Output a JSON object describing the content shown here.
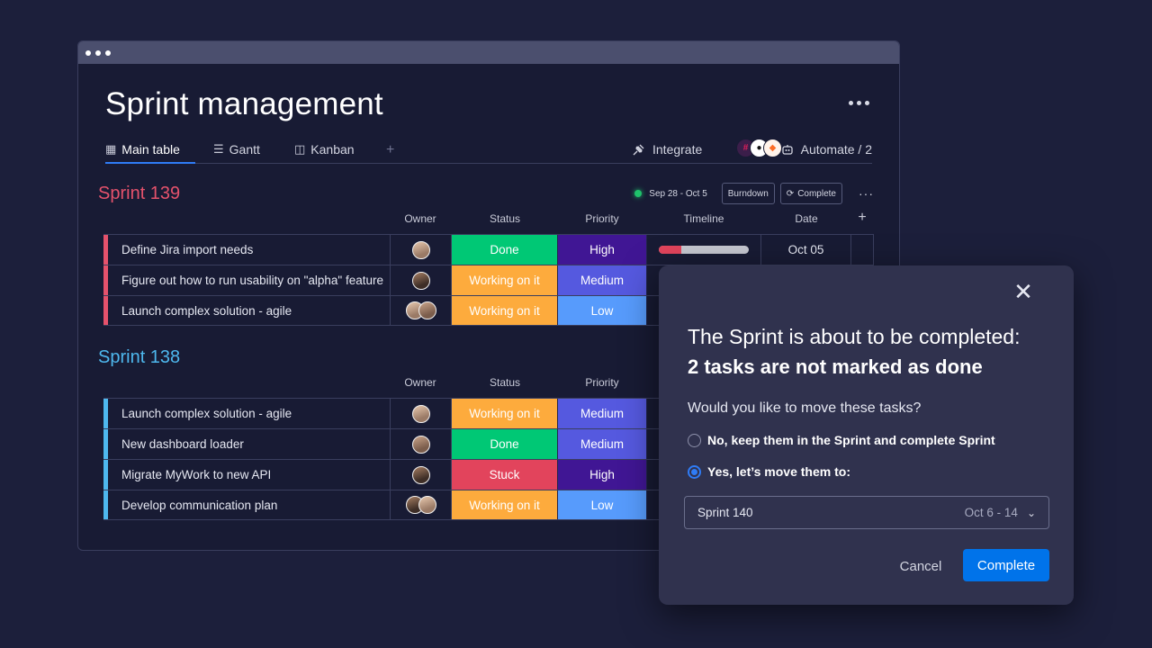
{
  "page": {
    "title": "Sprint management",
    "more_icon": "more-horizontal-icon"
  },
  "tabs": [
    {
      "label": "Main table",
      "icon": "table-icon",
      "active": true
    },
    {
      "label": "Gantt",
      "icon": "gantt-icon",
      "active": false
    },
    {
      "label": "Kanban",
      "icon": "kanban-icon",
      "active": false
    }
  ],
  "tab_add": "+",
  "toolbar": {
    "integrate_label": "Integrate",
    "integration_icons": [
      "slack-icon",
      "github-icon",
      "gitlab-icon"
    ],
    "automate_label": "Automate / 2"
  },
  "columns": {
    "owner": "Owner",
    "status": "Status",
    "priority": "Priority",
    "timeline": "Timeline",
    "date": "Date",
    "add": "+"
  },
  "sprint139": {
    "title": "Sprint 139",
    "date_range": "Sep 28 - Oct 5",
    "burndown_label": "Burndown",
    "complete_label": "Complete",
    "more": "···",
    "rows": [
      {
        "task": "Define Jira import needs",
        "status": "Done",
        "priority": "High",
        "timeline_progress": 0.25,
        "date": "Oct 05"
      },
      {
        "task": "Figure out how to run usability on \"alpha\" feature",
        "status": "Working on it",
        "priority": "Medium"
      },
      {
        "task": "Launch complex solution - agile",
        "status": "Working on it",
        "priority": "Low"
      }
    ]
  },
  "sprint138": {
    "title": "Sprint 138",
    "rows": [
      {
        "task": "Launch complex solution - agile",
        "status": "Working on it",
        "priority": "Medium"
      },
      {
        "task": "New dashboard loader",
        "status": "Done",
        "priority": "Medium"
      },
      {
        "task": "Migrate MyWork to new API",
        "status": "Stuck",
        "priority": "High"
      },
      {
        "task": "Develop communication plan",
        "status": "Working on it",
        "priority": "Low"
      }
    ]
  },
  "modal": {
    "title_line1": "The Sprint is about to be completed:",
    "title_line2": "2 tasks are not marked as done",
    "question": "Would you like to move these tasks?",
    "option_keep": "No, keep them in the Sprint and complete Sprint",
    "option_move": "Yes, let’s move them to:",
    "selected_option": "option_move",
    "target_sprint": "Sprint 140",
    "target_dates": "Oct 6 - 14",
    "cancel_label": "Cancel",
    "complete_label": "Complete"
  },
  "colors": {
    "background": "#1c1f3b",
    "window": "#181b34",
    "modal": "#30324e",
    "sprint139": "#e5526c",
    "sprint138": "#4eb8ee",
    "done": "#00c875",
    "working": "#fdab3d",
    "stuck": "#e2445c",
    "high": "#401694",
    "medium": "#5559df",
    "low": "#579bfc",
    "primary": "#0073ea"
  }
}
